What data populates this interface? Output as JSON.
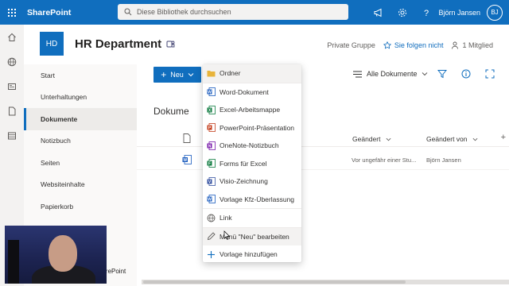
{
  "topbar": {
    "app_name": "SharePoint",
    "search_placeholder": "Diese Bibliothek durchsuchen",
    "user_name": "Björn Jansen",
    "user_initials": "BJ",
    "icons": [
      "waffle-icon",
      "megaphone-icon",
      "gear-icon",
      "help-icon"
    ]
  },
  "rail": {
    "icons": [
      "home-icon",
      "globe-icon",
      "news-icon",
      "file-icon",
      "lists-icon"
    ]
  },
  "site": {
    "logo_initials": "HD",
    "title": "HR Department",
    "group_type": "Private Gruppe",
    "follow_label": "Sie folgen nicht",
    "members_label": "1 Mitglied"
  },
  "leftnav": {
    "items": [
      {
        "label": "Start",
        "active": false
      },
      {
        "label": "Unterhaltungen",
        "active": false
      },
      {
        "label": "Dokumente",
        "active": true
      },
      {
        "label": "Notizbuch",
        "active": false
      },
      {
        "label": "Seiten",
        "active": false
      },
      {
        "label": "Websiteinhalte",
        "active": false
      },
      {
        "label": "Papierkorb",
        "active": false
      }
    ],
    "footer_text": "harePoint"
  },
  "commandbar": {
    "new_label": "Neu",
    "view_label": "Alle Dokumente"
  },
  "library": {
    "title": "Dokume",
    "columns": {
      "modified": "Geändert",
      "modified_by": "Geändert von"
    },
    "rows": [
      {
        "modified": "Vor ungefähr einer Stu...",
        "modified_by": "Björn Jansen"
      }
    ]
  },
  "new_menu": {
    "items": [
      {
        "label": "Ordner",
        "icon": "folder-icon",
        "color": "#e8b43b"
      },
      {
        "label": "Word-Dokument",
        "icon": "word-icon",
        "color": "#185abd"
      },
      {
        "label": "Excel-Arbeitsmappe",
        "icon": "excel-icon",
        "color": "#107c41"
      },
      {
        "label": "PowerPoint-Präsentation",
        "icon": "powerpoint-icon",
        "color": "#c43e1c"
      },
      {
        "label": "OneNote-Notizbuch",
        "icon": "onenote-icon",
        "color": "#7719aa"
      },
      {
        "label": "Forms für Excel",
        "icon": "forms-excel-icon",
        "color": "#107c41"
      },
      {
        "label": "Visio-Zeichnung",
        "icon": "visio-icon",
        "color": "#3955a3"
      },
      {
        "label": "Vorlage Kfz-Überlassung",
        "icon": "word-template-icon",
        "color": "#185abd"
      },
      {
        "label": "Link",
        "icon": "link-globe-icon",
        "color": "#605e5c"
      },
      {
        "label": "Menü \"Neu\" bearbeiten",
        "icon": "pencil-icon",
        "color": "#605e5c"
      },
      {
        "label": "Vorlage hinzufügen",
        "icon": "plus-icon",
        "color": "#106ebe"
      }
    ]
  }
}
